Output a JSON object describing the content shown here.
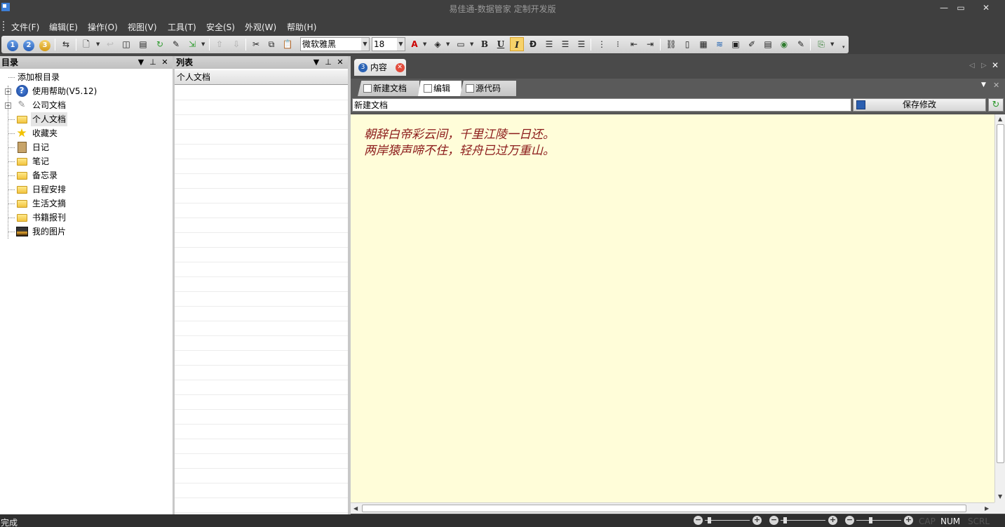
{
  "window": {
    "title": "易佳通-数据管家 定制开发版",
    "minimize": "—",
    "maximize": "▭",
    "close": "✕"
  },
  "menu": [
    "文件(F)",
    "编辑(E)",
    "操作(O)",
    "视图(V)",
    "工具(T)",
    "安全(S)",
    "外观(W)",
    "帮助(H)"
  ],
  "toolbar": {
    "view1": "1",
    "view2": "2",
    "view3": "3",
    "font_name": "微软雅黑",
    "font_size": "18",
    "bold": "B",
    "underline": "U",
    "italic": "I",
    "strike": "Ð"
  },
  "directory_panel": {
    "title": "目录",
    "items": [
      {
        "label": "添加根目录",
        "icon": "none"
      },
      {
        "label": "使用帮助(V5.12)",
        "icon": "help-icon"
      },
      {
        "label": "公司文档",
        "icon": "document-icon"
      },
      {
        "label": "个人文档",
        "icon": "folder-icon"
      },
      {
        "label": "收藏夹",
        "icon": "star-icon"
      },
      {
        "label": "日记",
        "icon": "clipboard-icon"
      },
      {
        "label": "笔记",
        "icon": "folder-icon"
      },
      {
        "label": "备忘录",
        "icon": "folder-icon"
      },
      {
        "label": "日程安排",
        "icon": "folder-icon"
      },
      {
        "label": "生活文摘",
        "icon": "folder-icon"
      },
      {
        "label": "书籍报刊",
        "icon": "folder-icon"
      },
      {
        "label": "我的图片",
        "icon": "picture-icon"
      }
    ]
  },
  "list_panel": {
    "title": "列表",
    "column_header": "个人文档"
  },
  "content": {
    "doc_tab": "内容",
    "doc_tab_number": "3",
    "subtabs": [
      "新建文档",
      "编辑",
      "源代码"
    ],
    "active_subtab": "编辑",
    "doc_title_value": "新建文档",
    "save_button": "保存修改",
    "body_lines": [
      "朝辞白帝彩云间，千里江陵一日还。",
      "两岸猿声啼不住，轻舟已过万重山。"
    ],
    "text_color": "#8b1a1a",
    "background_color": "#fffdd9"
  },
  "statusbar": {
    "status": "完成",
    "caps": "CAP",
    "num": "NUM",
    "scroll": "SCRL"
  }
}
